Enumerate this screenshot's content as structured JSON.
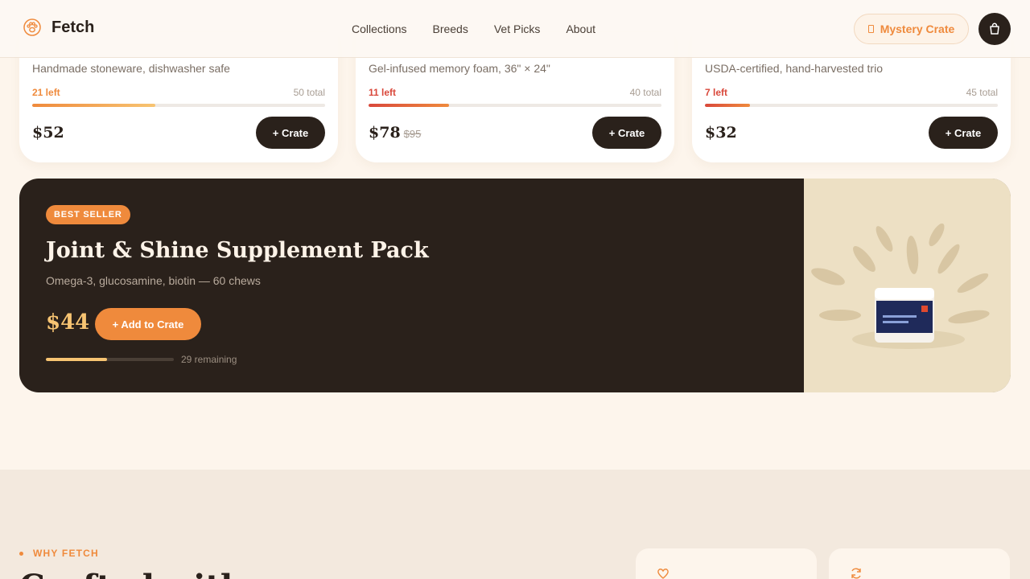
{
  "header": {
    "brand": "Fetch",
    "nav": [
      "Collections",
      "Breeds",
      "Vet Picks",
      "About"
    ],
    "mystery_label": "Mystery Crate"
  },
  "products": [
    {
      "desc": "Handmade stoneware, dishwasher safe",
      "left": "21 left",
      "total": "50 total",
      "stock_fraction": 0.42,
      "price": "$52",
      "old_price": "",
      "button": "+ Crate",
      "color": "#ef8a3c"
    },
    {
      "desc": "Gel-infused memory foam, 36\" × 24\"",
      "left": "11 left",
      "total": "40 total",
      "stock_fraction": 0.275,
      "price": "$78",
      "old_price": "$95",
      "button": "+ Crate",
      "color": "#d9483b"
    },
    {
      "desc": "USDA-certified, hand-harvested trio",
      "left": "7 left",
      "total": "45 total",
      "stock_fraction": 0.155,
      "price": "$32",
      "old_price": "",
      "button": "+ Crate",
      "color": "#d9483b"
    }
  ],
  "featured": {
    "badge": "BEST SELLER",
    "title": "Joint & Shine Supplement Pack",
    "desc": "Omega-3, glucosamine, biotin — 60 chews",
    "price": "$44",
    "button": "+ Add to Crate",
    "remaining": "29 remaining",
    "stock_fraction": 0.48
  },
  "why": {
    "label": "WHY FETCH",
    "heading": "Crafted with care",
    "cards": [
      {
        "icon": "heart-icon"
      },
      {
        "icon": "refresh-icon"
      }
    ]
  },
  "colors": {
    "accent": "#ef8a3c",
    "dark": "#2a211b",
    "gold": "#f7c472",
    "low_stock": "#d9483b"
  }
}
